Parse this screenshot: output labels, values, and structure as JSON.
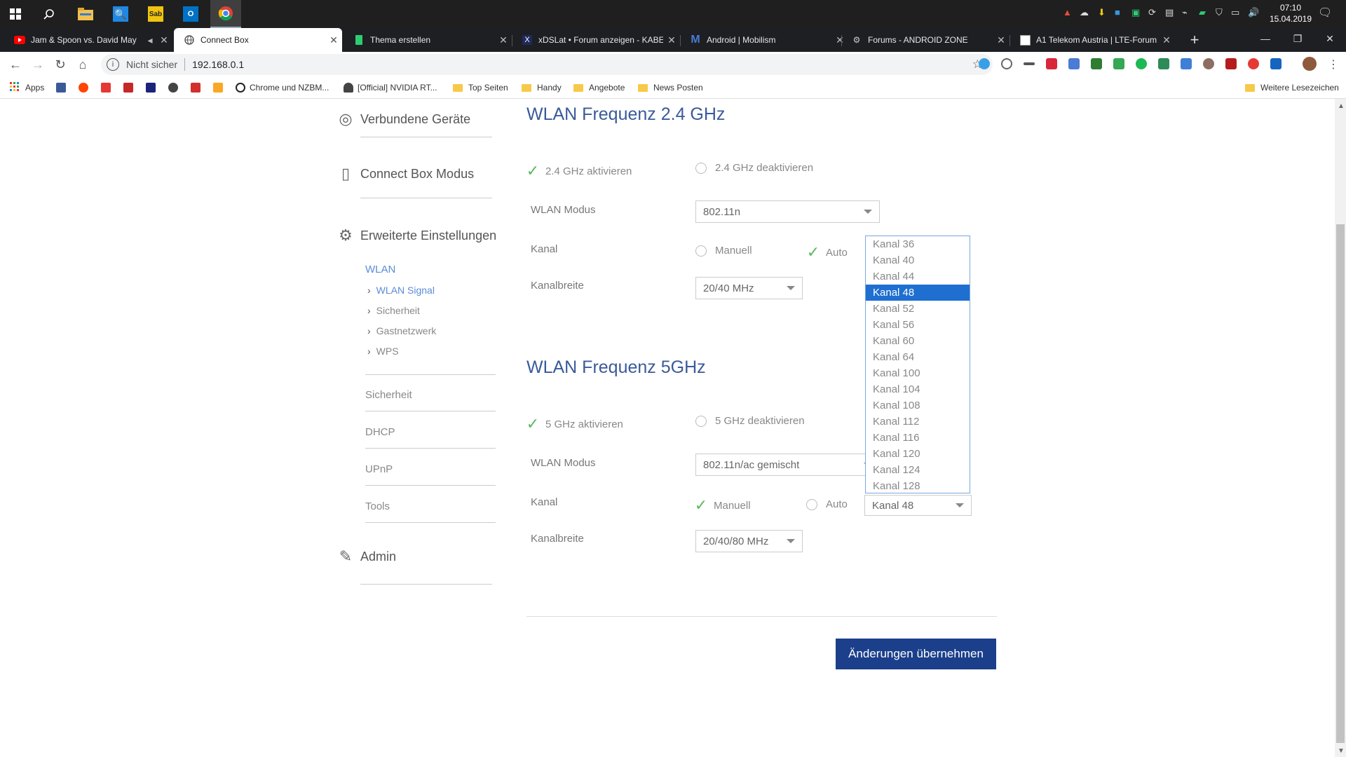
{
  "taskbar": {
    "clock_time": "07:10",
    "clock_date": "15.04.2019"
  },
  "tabs": [
    {
      "title": "Jam & Spoon vs. David May",
      "icon": "youtube-icon",
      "active": false
    },
    {
      "title": "Connect Box",
      "icon": "globe-icon",
      "active": true
    },
    {
      "title": "Thema erstellen",
      "icon": "android-doc-icon",
      "active": false
    },
    {
      "title": "xDSLat • Forum anzeigen - KABE",
      "icon": "xdsl-icon",
      "active": false
    },
    {
      "title": "Android | Mobilism",
      "icon": "mobilism-icon",
      "active": false
    },
    {
      "title": "Forums - ANDROID ZONE",
      "icon": "android-icon",
      "active": false
    },
    {
      "title": "A1 Telekom Austria | LTE-Forum",
      "icon": "a1-icon",
      "active": false
    }
  ],
  "toolbar": {
    "security_label": "Nicht sicher",
    "url": "192.168.0.1"
  },
  "bookmarks": {
    "apps_label": "Apps",
    "items": [
      {
        "label": "Chrome und NZBM...",
        "icon": "chrome-bw-icon"
      },
      {
        "label": "[Official] NVIDIA RT...",
        "icon": "flame-icon"
      },
      {
        "label": "Top Seiten",
        "icon": "folder-icon"
      },
      {
        "label": "Handy",
        "icon": "folder-icon"
      },
      {
        "label": "Angebote",
        "icon": "folder-icon"
      },
      {
        "label": "News Posten",
        "icon": "folder-icon"
      }
    ],
    "more_label": "Weitere Lesezeichen"
  },
  "sidebar": {
    "connected_devices": "Verbundene Geräte",
    "box_mode": "Connect Box Modus",
    "advanced": "Erweiterte Einstellungen",
    "wlan": "WLAN",
    "wlan_sub": [
      "WLAN Signal",
      "Sicherheit",
      "Gastnetzwerk",
      "WPS"
    ],
    "sections": [
      "Sicherheit",
      "DHCP",
      "UPnP",
      "Tools"
    ],
    "admin": "Admin"
  },
  "band24": {
    "title": "WLAN Frequenz 2.4 GHz",
    "enable_label": "2.4 GHz aktivieren",
    "disable_label": "2.4 GHz deaktivieren",
    "mode_label": "WLAN Modus",
    "mode_value": "802.11n",
    "channel_label": "Kanal",
    "manual_label": "Manuell",
    "auto_label": "Auto",
    "width_label": "Kanalbreite",
    "width_value": "20/40 MHz"
  },
  "band5": {
    "title": "WLAN Frequenz 5GHz",
    "enable_label": "5 GHz aktivieren",
    "disable_label": "5 GHz deaktivieren",
    "mode_label": "WLAN Modus",
    "mode_value": "802.11n/ac gemischt",
    "channel_label": "Kanal",
    "manual_label": "Manuell",
    "auto_label": "Auto",
    "channel_value": "Kanal 48",
    "width_label": "Kanalbreite",
    "width_value": "20/40/80 MHz"
  },
  "channel_dropdown": {
    "options": [
      "Kanal 36",
      "Kanal 40",
      "Kanal 44",
      "Kanal 48",
      "Kanal 52",
      "Kanal 56",
      "Kanal 60",
      "Kanal 64",
      "Kanal 100",
      "Kanal 104",
      "Kanal 108",
      "Kanal 112",
      "Kanal 116",
      "Kanal 120",
      "Kanal 124",
      "Kanal 128"
    ],
    "selected": "Kanal 48"
  },
  "apply_label": "Änderungen übernehmen",
  "colors": {
    "accent": "#1b3f8a",
    "link": "#5a8cd6",
    "check": "#5cb85c",
    "selection": "#1e6fd0"
  }
}
